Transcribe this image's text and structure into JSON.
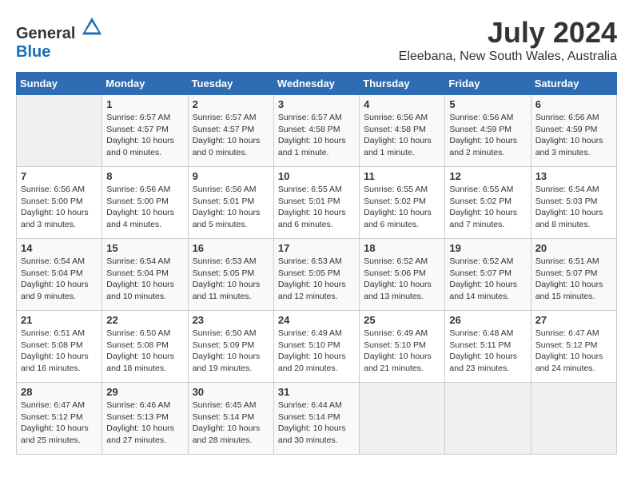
{
  "logo": {
    "text_general": "General",
    "text_blue": "Blue"
  },
  "title": "July 2024",
  "subtitle": "Eleebana, New South Wales, Australia",
  "weekdays": [
    "Sunday",
    "Monday",
    "Tuesday",
    "Wednesday",
    "Thursday",
    "Friday",
    "Saturday"
  ],
  "weeks": [
    [
      {
        "day": "",
        "info": ""
      },
      {
        "day": "1",
        "info": "Sunrise: 6:57 AM\nSunset: 4:57 PM\nDaylight: 10 hours\nand 0 minutes."
      },
      {
        "day": "2",
        "info": "Sunrise: 6:57 AM\nSunset: 4:57 PM\nDaylight: 10 hours\nand 0 minutes."
      },
      {
        "day": "3",
        "info": "Sunrise: 6:57 AM\nSunset: 4:58 PM\nDaylight: 10 hours\nand 1 minute."
      },
      {
        "day": "4",
        "info": "Sunrise: 6:56 AM\nSunset: 4:58 PM\nDaylight: 10 hours\nand 1 minute."
      },
      {
        "day": "5",
        "info": "Sunrise: 6:56 AM\nSunset: 4:59 PM\nDaylight: 10 hours\nand 2 minutes."
      },
      {
        "day": "6",
        "info": "Sunrise: 6:56 AM\nSunset: 4:59 PM\nDaylight: 10 hours\nand 3 minutes."
      }
    ],
    [
      {
        "day": "7",
        "info": "Sunrise: 6:56 AM\nSunset: 5:00 PM\nDaylight: 10 hours\nand 3 minutes."
      },
      {
        "day": "8",
        "info": "Sunrise: 6:56 AM\nSunset: 5:00 PM\nDaylight: 10 hours\nand 4 minutes."
      },
      {
        "day": "9",
        "info": "Sunrise: 6:56 AM\nSunset: 5:01 PM\nDaylight: 10 hours\nand 5 minutes."
      },
      {
        "day": "10",
        "info": "Sunrise: 6:55 AM\nSunset: 5:01 PM\nDaylight: 10 hours\nand 6 minutes."
      },
      {
        "day": "11",
        "info": "Sunrise: 6:55 AM\nSunset: 5:02 PM\nDaylight: 10 hours\nand 6 minutes."
      },
      {
        "day": "12",
        "info": "Sunrise: 6:55 AM\nSunset: 5:02 PM\nDaylight: 10 hours\nand 7 minutes."
      },
      {
        "day": "13",
        "info": "Sunrise: 6:54 AM\nSunset: 5:03 PM\nDaylight: 10 hours\nand 8 minutes."
      }
    ],
    [
      {
        "day": "14",
        "info": "Sunrise: 6:54 AM\nSunset: 5:04 PM\nDaylight: 10 hours\nand 9 minutes."
      },
      {
        "day": "15",
        "info": "Sunrise: 6:54 AM\nSunset: 5:04 PM\nDaylight: 10 hours\nand 10 minutes."
      },
      {
        "day": "16",
        "info": "Sunrise: 6:53 AM\nSunset: 5:05 PM\nDaylight: 10 hours\nand 11 minutes."
      },
      {
        "day": "17",
        "info": "Sunrise: 6:53 AM\nSunset: 5:05 PM\nDaylight: 10 hours\nand 12 minutes."
      },
      {
        "day": "18",
        "info": "Sunrise: 6:52 AM\nSunset: 5:06 PM\nDaylight: 10 hours\nand 13 minutes."
      },
      {
        "day": "19",
        "info": "Sunrise: 6:52 AM\nSunset: 5:07 PM\nDaylight: 10 hours\nand 14 minutes."
      },
      {
        "day": "20",
        "info": "Sunrise: 6:51 AM\nSunset: 5:07 PM\nDaylight: 10 hours\nand 15 minutes."
      }
    ],
    [
      {
        "day": "21",
        "info": "Sunrise: 6:51 AM\nSunset: 5:08 PM\nDaylight: 10 hours\nand 16 minutes."
      },
      {
        "day": "22",
        "info": "Sunrise: 6:50 AM\nSunset: 5:08 PM\nDaylight: 10 hours\nand 18 minutes."
      },
      {
        "day": "23",
        "info": "Sunrise: 6:50 AM\nSunset: 5:09 PM\nDaylight: 10 hours\nand 19 minutes."
      },
      {
        "day": "24",
        "info": "Sunrise: 6:49 AM\nSunset: 5:10 PM\nDaylight: 10 hours\nand 20 minutes."
      },
      {
        "day": "25",
        "info": "Sunrise: 6:49 AM\nSunset: 5:10 PM\nDaylight: 10 hours\nand 21 minutes."
      },
      {
        "day": "26",
        "info": "Sunrise: 6:48 AM\nSunset: 5:11 PM\nDaylight: 10 hours\nand 23 minutes."
      },
      {
        "day": "27",
        "info": "Sunrise: 6:47 AM\nSunset: 5:12 PM\nDaylight: 10 hours\nand 24 minutes."
      }
    ],
    [
      {
        "day": "28",
        "info": "Sunrise: 6:47 AM\nSunset: 5:12 PM\nDaylight: 10 hours\nand 25 minutes."
      },
      {
        "day": "29",
        "info": "Sunrise: 6:46 AM\nSunset: 5:13 PM\nDaylight: 10 hours\nand 27 minutes."
      },
      {
        "day": "30",
        "info": "Sunrise: 6:45 AM\nSunset: 5:14 PM\nDaylight: 10 hours\nand 28 minutes."
      },
      {
        "day": "31",
        "info": "Sunrise: 6:44 AM\nSunset: 5:14 PM\nDaylight: 10 hours\nand 30 minutes."
      },
      {
        "day": "",
        "info": ""
      },
      {
        "day": "",
        "info": ""
      },
      {
        "day": "",
        "info": ""
      }
    ]
  ]
}
